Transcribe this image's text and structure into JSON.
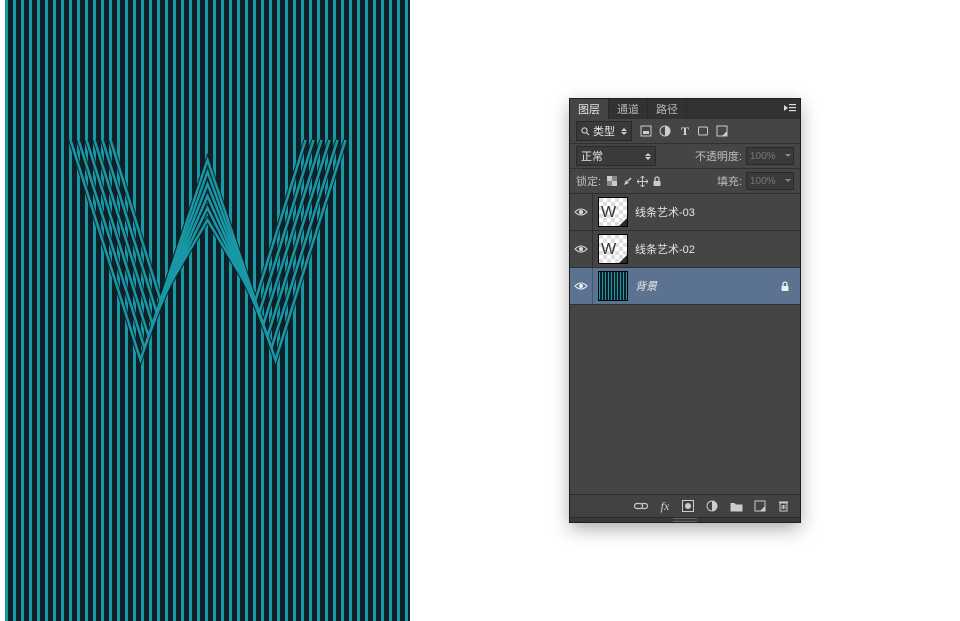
{
  "canvas": {
    "stripe_color": "#1898a6",
    "bg_color": "#0e2026"
  },
  "panel": {
    "tabs": {
      "layers": "图层",
      "channels": "通道",
      "paths": "路径",
      "active": "layers"
    },
    "filter": {
      "kind_label": "类型",
      "icons": {
        "pixel": "pixel-filter-icon",
        "adjust": "adjustment-filter-icon",
        "type": "T",
        "shape": "shape-filter-icon",
        "smart": "smart-filter-icon"
      }
    },
    "blend": {
      "mode": "正常",
      "opacity_label": "不透明度:",
      "opacity_value": "100%"
    },
    "lock": {
      "label": "锁定:",
      "fill_label": "填充:",
      "fill_value": "100%"
    },
    "layers": [
      {
        "name": "线条艺术-03",
        "visible": true,
        "kind": "smart-w",
        "selected": false,
        "locked": false
      },
      {
        "name": "线条艺术-02",
        "visible": true,
        "kind": "smart-w",
        "selected": false,
        "locked": false
      },
      {
        "name": "背景",
        "visible": true,
        "kind": "bg",
        "selected": true,
        "locked": true
      }
    ],
    "footer": {
      "link": "link-icon",
      "fx": "fx",
      "mask": "mask-icon",
      "adj": "adjustment-icon",
      "group": "group-icon",
      "new": "new-layer-icon",
      "trash": "trash-icon"
    }
  }
}
